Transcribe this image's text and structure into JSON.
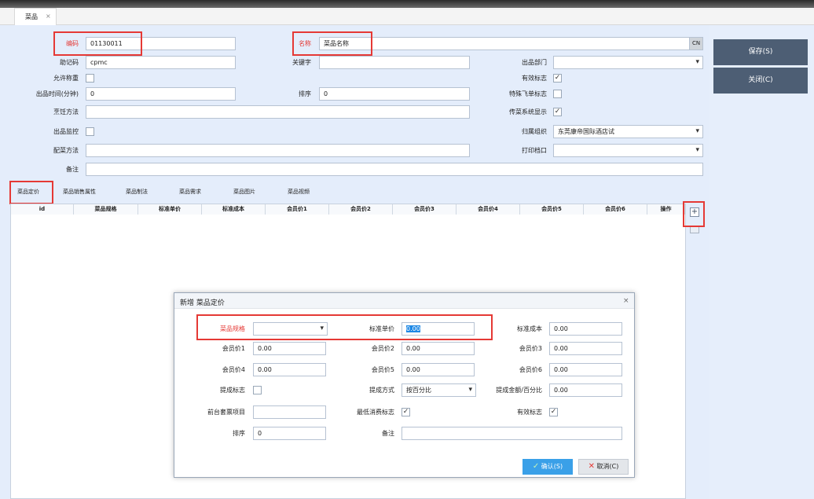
{
  "tab": {
    "title": "菜品",
    "close": "×"
  },
  "form": {
    "code_label": "编码",
    "code_value": "01130011",
    "name_label": "名称",
    "name_value": "菜品名称",
    "cn_label": "CN",
    "mnemonic_label": "助记码",
    "mnemonic_value": "cpmc",
    "keyword_label": "关键字",
    "keyword_value": "",
    "dept_label": "出品部门",
    "dept_value": "",
    "allow_weigh_label": "允许称重",
    "valid_label": "有效标志",
    "valid_checked": "✓",
    "time_label": "出品时间(分钟)",
    "time_value": "0",
    "sort_label": "排序",
    "sort_value": "0",
    "special_label": "特殊飞单标志",
    "cook_label": "烹饪方法",
    "cook_value": "",
    "transfer_label": "传菜系统显示",
    "transfer_checked": "✓",
    "monitor_label": "出品监控",
    "org_label": "归属组织",
    "org_value": "东莞康帝国际酒店试",
    "side_label": "配菜方法",
    "side_value": "",
    "print_label": "打印档口",
    "print_value": "",
    "remark_label": "备注",
    "remark_value": ""
  },
  "actions": {
    "save": "保存(S)",
    "close": "关闭(C)"
  },
  "subtabs": [
    "菜品定价",
    "菜品销售属性",
    "菜品制法",
    "菜品需求",
    "菜品图片",
    "菜品视频"
  ],
  "grid_columns": [
    "id",
    "菜品规格",
    "标准单价",
    "标准成本",
    "会员价1",
    "会员价2",
    "会员价3",
    "会员价4",
    "会员价5",
    "会员价6",
    "操作"
  ],
  "dialog": {
    "title": "新增 菜品定价",
    "close": "×",
    "spec_label": "菜品规格",
    "spec_value": "",
    "std_price_label": "标准单价",
    "std_price_value": "0.00",
    "std_cost_label": "标准成本",
    "std_cost_value": "0.00",
    "mp1_label": "会员价1",
    "mp1_value": "0.00",
    "mp2_label": "会员价2",
    "mp2_value": "0.00",
    "mp3_label": "会员价3",
    "mp3_value": "0.00",
    "mp4_label": "会员价4",
    "mp4_value": "0.00",
    "mp5_label": "会员价5",
    "mp5_value": "0.00",
    "mp6_label": "会员价6",
    "mp6_value": "0.00",
    "commission_flag_label": "提成标志",
    "commission_mode_label": "提成方式",
    "commission_mode_value": "按百分比",
    "commission_amount_label": "提成金额/百分比",
    "commission_amount_value": "0.00",
    "package_label": "前台套票项目",
    "package_value": "",
    "min_consume_label": "最低消费标志",
    "min_consume_checked": "✓",
    "valid_label": "有效标志",
    "valid_checked": "✓",
    "sort_label": "排序",
    "sort_value": "0",
    "remark_label": "备注",
    "remark_value": "",
    "confirm": "确认(S)",
    "cancel": "取消(C)"
  },
  "colors": {
    "accent": "#1e88e5",
    "highlight": "#e53935",
    "dark_button": "#4d5e74",
    "panel": "#e4edfb"
  }
}
